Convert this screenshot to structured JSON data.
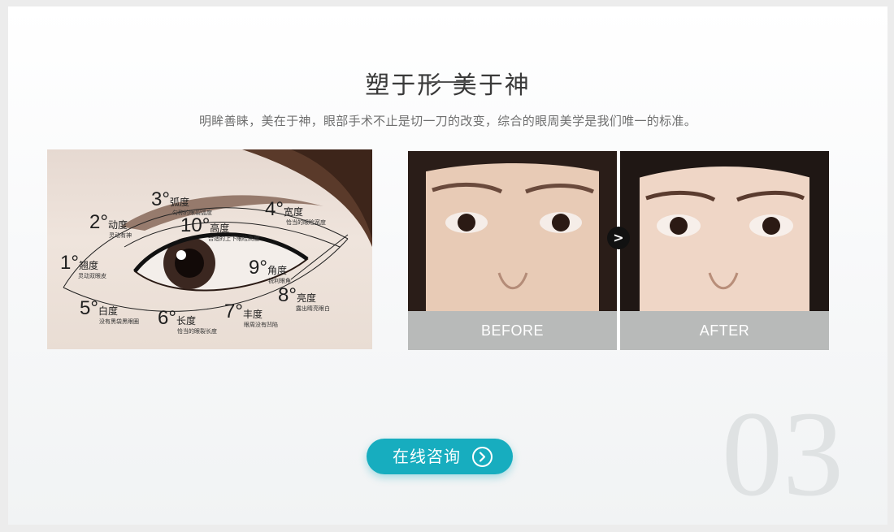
{
  "section": {
    "title": "塑于形 美于神",
    "subtitle": "明眸善睐，美在于神，眼部手术不止是切一刀的改变，综合的眼周美学是我们唯一的标准。",
    "watermark": "03"
  },
  "eye_diagram": {
    "labels": [
      {
        "num": "1°",
        "name": "翘度",
        "desc": "灵动双眼皮"
      },
      {
        "num": "2°",
        "name": "动度",
        "desc": "灵动有神"
      },
      {
        "num": "3°",
        "name": "弧度",
        "desc": "匀称的眼裂弧度"
      },
      {
        "num": "4°",
        "name": "宽度",
        "desc": "恰当的眼睑宽度"
      },
      {
        "num": "5°",
        "name": "白度",
        "desc": "没有黑袋黑眼圈"
      },
      {
        "num": "6°",
        "name": "长度",
        "desc": "恰当的眼裂长度"
      },
      {
        "num": "7°",
        "name": "丰度",
        "desc": "眼周没有凹陷"
      },
      {
        "num": "8°",
        "name": "亮度",
        "desc": "露出睛亮眼白"
      },
      {
        "num": "9°",
        "name": "角度",
        "desc": "锐利眼角"
      },
      {
        "num": "10°",
        "name": "高度",
        "desc": "合适的上下眼睑高度"
      }
    ]
  },
  "comparison": {
    "before_label": "BEFORE",
    "after_label": "AFTER",
    "arrow_glyph": ">"
  },
  "cta": {
    "label": "在线咨询",
    "icon": "chevron-right-circle-icon",
    "color": "#17adbf"
  }
}
